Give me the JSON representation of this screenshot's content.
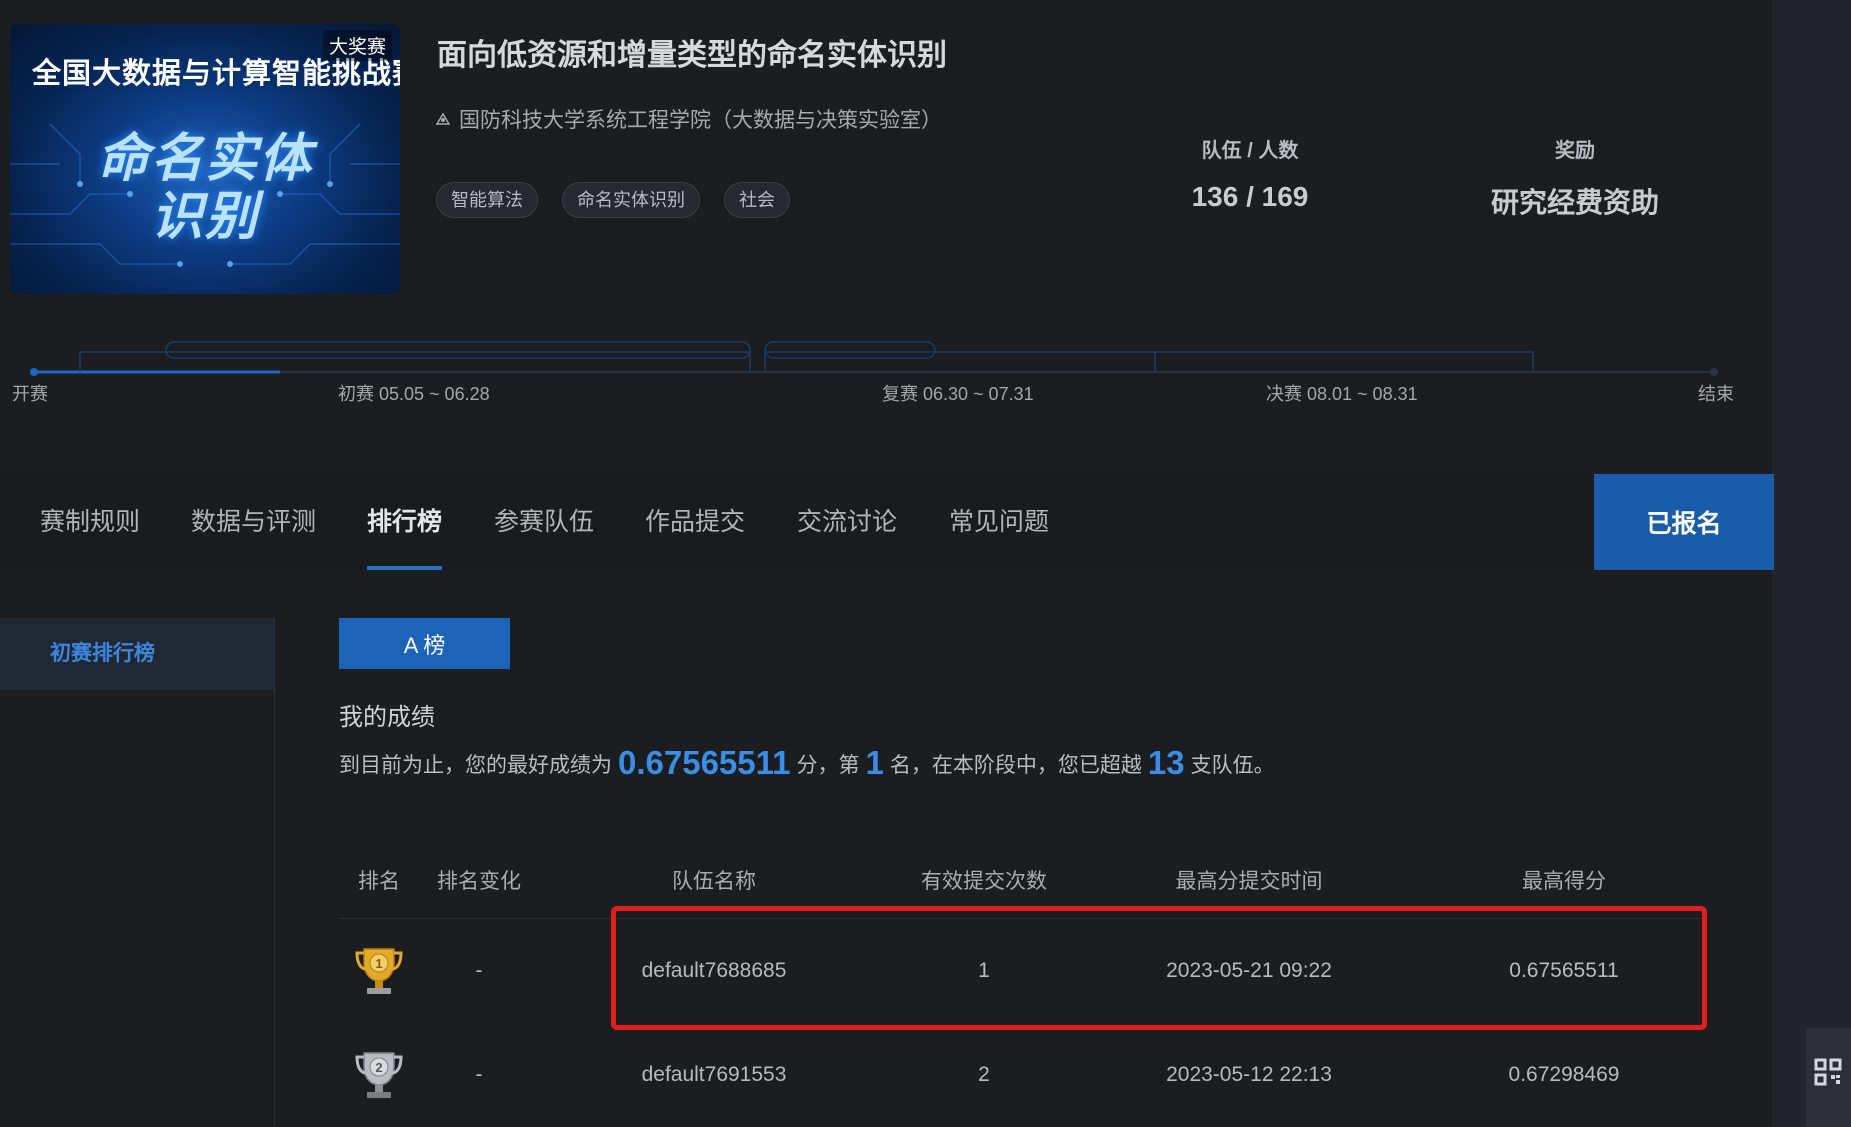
{
  "competition": {
    "cover": {
      "line1": "全国大数据与计算智能挑战赛",
      "line2a": "命名实体",
      "line2b": "识别",
      "badge": "大奖赛"
    },
    "title": "面向低资源和增量类型的命名实体识别",
    "organizer": "国防科技大学系统工程学院（大数据与决策实验室）",
    "tags": [
      "智能算法",
      "命名实体识别",
      "社会"
    ],
    "stats": {
      "teams_label": "队伍 / 人数",
      "teams_value": "136 / 169",
      "reward_label": "奖励",
      "reward_value": "研究经费资助"
    }
  },
  "timeline": {
    "start": "开赛",
    "prelim": "初赛 05.05 ~ 06.28",
    "semi": "复赛 06.30 ~ 07.31",
    "final": "决赛 08.01 ~ 08.31",
    "end": "结束"
  },
  "tabs": [
    {
      "label": "赛制规则",
      "active": false
    },
    {
      "label": "数据与评测",
      "active": false
    },
    {
      "label": "排行榜",
      "active": true
    },
    {
      "label": "参赛队伍",
      "active": false
    },
    {
      "label": "作品提交",
      "active": false
    },
    {
      "label": "交流讨论",
      "active": false
    },
    {
      "label": "常见问题",
      "active": false
    }
  ],
  "enroll_button": "已报名",
  "sidebar": {
    "item": "初赛排行榜"
  },
  "board": {
    "tab_a": "A 榜",
    "my_title": "我的成绩",
    "summary": {
      "p1": "到目前为止，您的最好成绩为",
      "score": "0.67565511",
      "p2": "分，第",
      "rank": "1",
      "p3": "名，在本阶段中，您已超越",
      "beaten": "13",
      "p4": "支队伍。"
    },
    "columns": [
      "排名",
      "排名变化",
      "队伍名称",
      "有效提交次数",
      "最高分提交时间",
      "最高得分"
    ],
    "rows": [
      {
        "rank": "1",
        "change": "-",
        "team": "default7688685",
        "submissions": "1",
        "time": "2023-05-21 09:22",
        "score": "0.67565511",
        "medal": "gold"
      },
      {
        "rank": "2",
        "change": "-",
        "team": "default7691553",
        "submissions": "2",
        "time": "2023-05-12 22:13",
        "score": "0.67298469",
        "medal": "silver"
      }
    ]
  },
  "colors": {
    "accent": "#3a8ee6",
    "button": "#1a5ca7",
    "highlight_box": "#e21d1d",
    "background": "#1c1d21"
  }
}
